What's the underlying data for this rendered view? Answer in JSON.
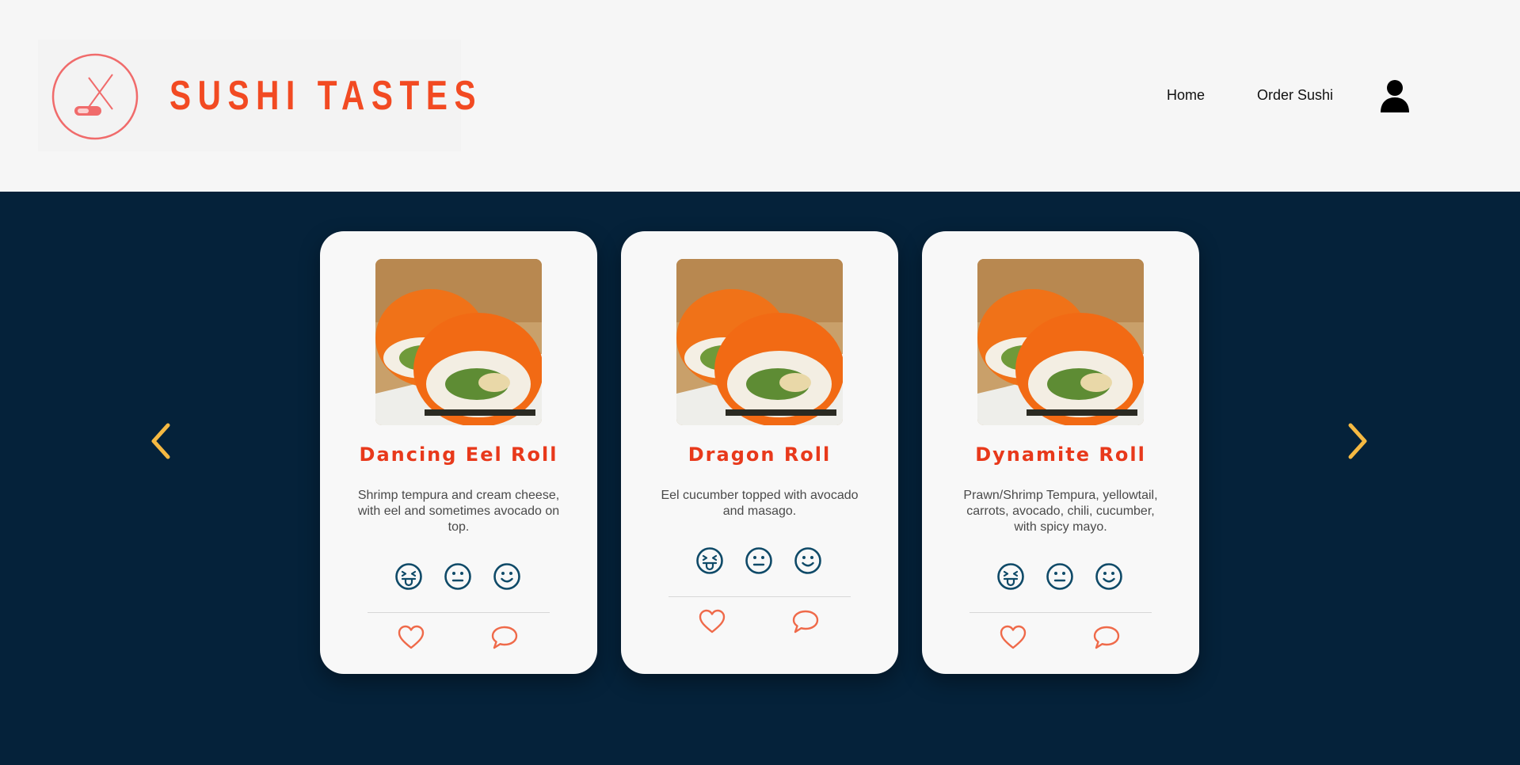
{
  "header": {
    "brand": "SUSHI TASTES",
    "nav": {
      "home_label": "Home",
      "order_label": "Order Sushi"
    },
    "icons": {
      "logo": "sushi-chopsticks-icon",
      "user": "user-icon"
    }
  },
  "carousel": {
    "prev_icon": "chevron-left-icon",
    "next_icon": "chevron-right-icon",
    "cards": [
      {
        "title": "Dancing Eel Roll",
        "description": "Shrimp tempura and cream cheese, with eel and sometimes avocado on top.",
        "ratings": [
          "disgusted-face-icon",
          "neutral-face-icon",
          "smiling-face-icon"
        ],
        "actions": [
          "heart-icon",
          "comment-icon"
        ]
      },
      {
        "title": "Dragon Roll",
        "description": "Eel cucumber topped with avocado and masago.",
        "ratings": [
          "disgusted-face-icon",
          "neutral-face-icon",
          "smiling-face-icon"
        ],
        "actions": [
          "heart-icon",
          "comment-icon"
        ]
      },
      {
        "title": "Dynamite Roll",
        "description": "Prawn/Shrimp Tempura, yellowtail, carrots, avocado, chili, cucumber, with spicy mayo.",
        "ratings": [
          "disgusted-face-icon",
          "neutral-face-icon",
          "smiling-face-icon"
        ],
        "actions": [
          "heart-icon",
          "comment-icon"
        ]
      }
    ]
  },
  "colors": {
    "brand_red": "#f24a22",
    "title_red": "#e8391b",
    "navy": "#05223a",
    "arrow_yellow": "#f5b942",
    "face_blue": "#0f4a68",
    "action_red": "#ef6a4a"
  }
}
